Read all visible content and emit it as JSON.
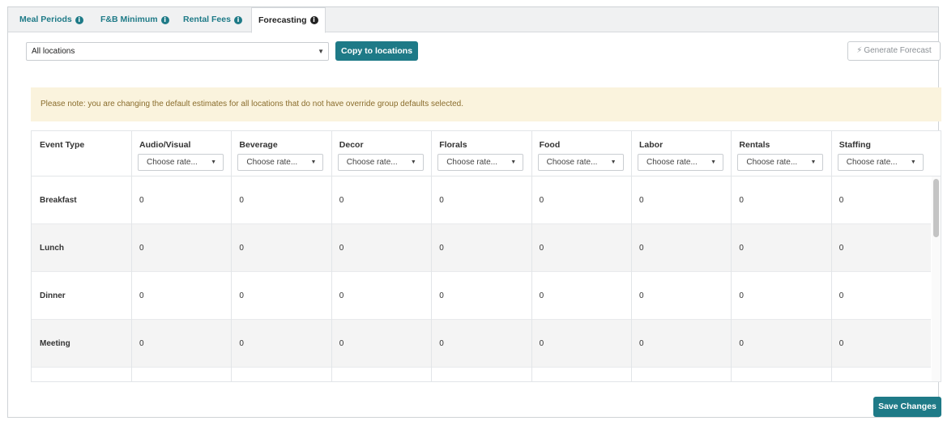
{
  "tabs": [
    {
      "label": "Meal Periods",
      "active": false
    },
    {
      "label": "F&B Minimum",
      "active": false
    },
    {
      "label": "Rental Fees",
      "active": false
    },
    {
      "label": "Forecasting",
      "active": true
    }
  ],
  "toolbar": {
    "location_value": "All locations",
    "copy_label": "Copy to locations",
    "generate_label": "Generate Forecast"
  },
  "notice": "Please note: you are changing the default estimates for all locations that do not have override group defaults selected.",
  "table": {
    "first_header": "Event Type",
    "rate_placeholder": "Choose rate...",
    "columns": [
      "Audio/Visual",
      "Beverage",
      "Decor",
      "Florals",
      "Food",
      "Labor",
      "Rentals",
      "Staffing"
    ],
    "rows": [
      {
        "event": "Breakfast",
        "values": [
          "0",
          "0",
          "0",
          "0",
          "0",
          "0",
          "0",
          "0"
        ]
      },
      {
        "event": "Lunch",
        "values": [
          "0",
          "0",
          "0",
          "0",
          "0",
          "0",
          "0",
          "0"
        ]
      },
      {
        "event": "Dinner",
        "values": [
          "0",
          "0",
          "0",
          "0",
          "0",
          "0",
          "0",
          "0"
        ]
      },
      {
        "event": "Meeting",
        "values": [
          "0",
          "0",
          "0",
          "0",
          "0",
          "0",
          "0",
          "0"
        ]
      },
      {
        "event": "",
        "values": [
          "",
          "",
          "",
          "",
          "",
          "",
          "",
          ""
        ]
      }
    ]
  },
  "footer": {
    "save_label": "Save Changes"
  },
  "colors": {
    "accent": "#1e7a87",
    "notice_bg": "#faf3dd",
    "notice_text": "#8a6d2d"
  }
}
